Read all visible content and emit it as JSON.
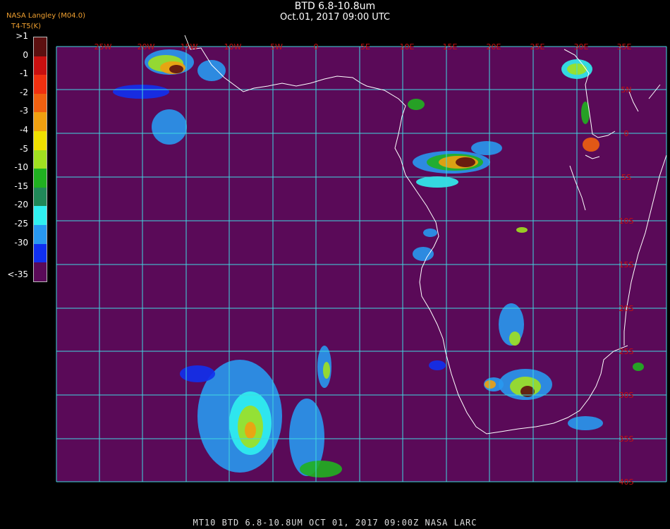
{
  "header": {
    "title": "BTD 6.8-10.8um",
    "timestamp": "Oct.01, 2017 09:00 UTC",
    "agency": "NASA Langley (M04.0)",
    "unit_label": "T4-T5(K)"
  },
  "colorbar": {
    "labels": [
      ">1",
      "0",
      "-1",
      "-2",
      "-3",
      "-4",
      "-5",
      "-10",
      "-15",
      "-20",
      "-25",
      "-30",
      "<-35"
    ],
    "colors": [
      "#5c1010",
      "#c81010",
      "#f03010",
      "#f06010",
      "#f0a010",
      "#f0e000",
      "#a0e020",
      "#20b020",
      "#208858",
      "#30f0f0",
      "#2898f0",
      "#1030f0",
      "#5a0a58"
    ]
  },
  "map": {
    "background_color": "#5a0a58",
    "grid_color": "#40d8e0",
    "coast_color": "#ffffff",
    "label_color": "#c81010",
    "lon_labels": [
      "25W",
      "20W",
      "15W",
      "10W",
      "5W",
      "0",
      "5E",
      "10E",
      "15E",
      "20E",
      "25E",
      "30E",
      "35E"
    ],
    "lat_labels": [
      "5N",
      "0",
      "5S",
      "10S",
      "15S",
      "20S",
      "25S",
      "30S",
      "35S",
      "40S"
    ]
  },
  "footer": {
    "caption": "MT10  BTD 6.8-10.8UM   OCT 01, 2017 09:00Z   NASA LARC"
  }
}
